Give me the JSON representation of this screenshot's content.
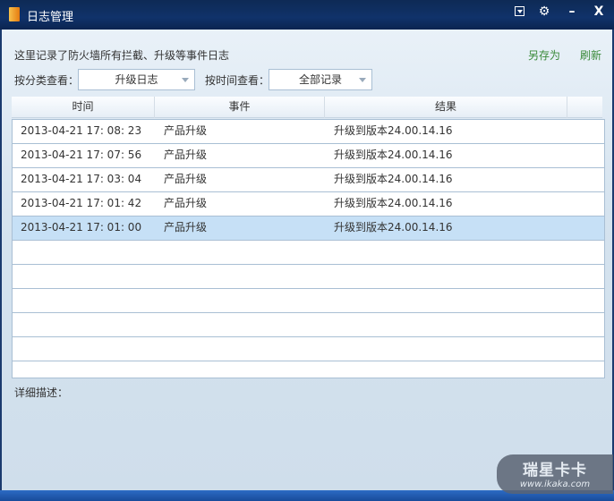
{
  "window": {
    "title": "日志管理",
    "buttons": [
      "menu",
      "settings",
      "minimize",
      "close"
    ]
  },
  "description": "这里记录了防火墙所有拦截、升级等事件日志",
  "actions": {
    "save_as": "另存为",
    "refresh": "刷新"
  },
  "filters": {
    "category_label": "按分类查看：",
    "category_value": "升级日志",
    "time_label": "按时间查看：",
    "time_value": "全部记录"
  },
  "table": {
    "headers": [
      "时间",
      "事件",
      "结果"
    ],
    "rows": [
      {
        "time": "2013-04-21 17: 08: 23",
        "event": "产品升级",
        "result": "升级到版本24.00.14.16"
      },
      {
        "time": "2013-04-21 17: 07: 56",
        "event": "产品升级",
        "result": "升级到版本24.00.14.16"
      },
      {
        "time": "2013-04-21 17: 03: 04",
        "event": "产品升级",
        "result": "升级到版本24.00.14.16"
      },
      {
        "time": "2013-04-21 17: 01: 42",
        "event": "产品升级",
        "result": "升级到版本24.00.14.16"
      },
      {
        "time": "2013-04-21 17: 01: 00",
        "event": "产品升级",
        "result": "升级到版本24.00.14.16"
      }
    ],
    "selected_index": 4
  },
  "detail_label": "详细描述：",
  "watermark": {
    "name": "瑞星卡卡",
    "url": "www.ikaka.com"
  }
}
